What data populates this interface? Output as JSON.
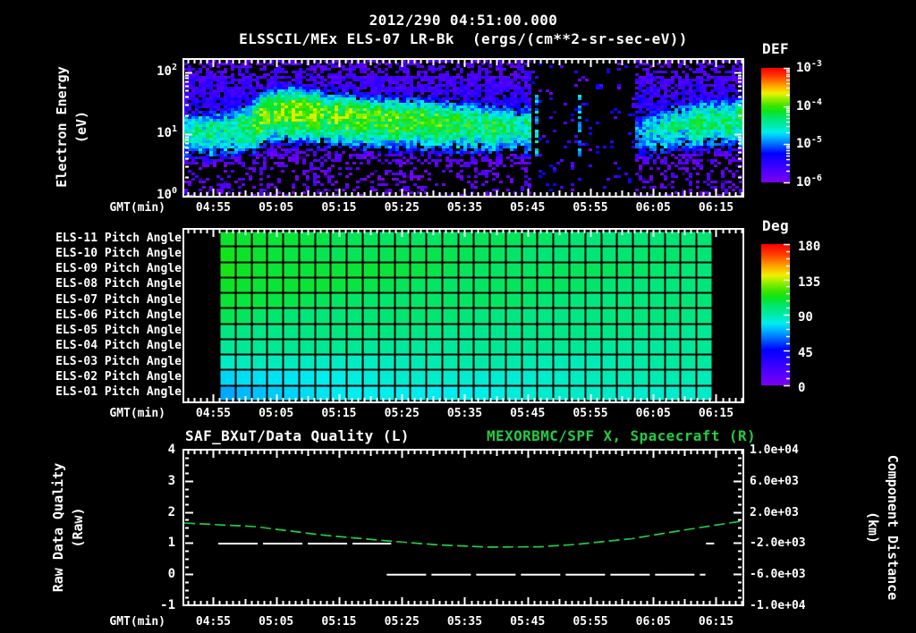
{
  "header": {
    "datetime": "2012/290 04:51:00.000",
    "instrument_title": "ELSSCIL/MEx ELS-07 LR-Bk  (ergs/(cm**2-sr-sec-eV))"
  },
  "colors": {
    "background": "#000000",
    "foreground": "#ffffff",
    "accent_green": "#22cc44",
    "rainbow_stops": [
      [
        0,
        "#7a00f0"
      ],
      [
        0.13,
        "#3c00ff"
      ],
      [
        0.25,
        "#0000ff"
      ],
      [
        0.33,
        "#0068ff"
      ],
      [
        0.39,
        "#00b4ff"
      ],
      [
        0.44,
        "#00eeee"
      ],
      [
        0.5,
        "#00eaa4"
      ],
      [
        0.56,
        "#00e674"
      ],
      [
        0.62,
        "#0ce41e"
      ],
      [
        0.67,
        "#3ce400"
      ],
      [
        0.73,
        "#96ee00"
      ],
      [
        0.78,
        "#f0f000"
      ],
      [
        0.85,
        "#ffa000"
      ],
      [
        0.93,
        "#ff3c00"
      ],
      [
        1,
        "#ff0000"
      ]
    ]
  },
  "time_axis": {
    "label": "GMT(min)",
    "range_min": [
      -0.62,
      88.2
    ],
    "tick_minutes": [
      4,
      14,
      24,
      34,
      44,
      54,
      64,
      74,
      84
    ],
    "tick_labels": [
      "04:55",
      "05:05",
      "05:15",
      "05:25",
      "05:35",
      "05:45",
      "05:55",
      "06:05",
      "06:15"
    ],
    "minor_step_min": 1
  },
  "chart_data": [
    {
      "type": "heatmap",
      "name": "electron-energy-spectrogram",
      "ylabel_line1": "Electron Energy",
      "ylabel_line2": "(eV)",
      "xlabel": "GMT(min)",
      "y_scale": "log",
      "y_ticks": [
        {
          "base": "10",
          "exp": "2",
          "log10": 2
        },
        {
          "base": "10",
          "exp": "1",
          "log10": 1
        },
        {
          "base": "10",
          "exp": "0",
          "log10": 0
        }
      ],
      "colorbar": {
        "title": "DEF",
        "units": "ergs/(cm**2-sr-sec-eV)",
        "tick_labels": [
          {
            "base": "10",
            "exp": "-3"
          },
          {
            "base": "10",
            "exp": "-4"
          },
          {
            "base": "10",
            "exp": "-5"
          },
          {
            "base": "10",
            "exp": "-6"
          }
        ],
        "range_log10": [
          -6,
          -3
        ]
      },
      "band_profile": [
        [
          -0.62,
          1.02,
          -4.55
        ],
        [
          6,
          1.06,
          -4.42
        ],
        [
          10,
          1.16,
          -4.15
        ],
        [
          12.5,
          1.35,
          -3.86
        ],
        [
          15,
          1.38,
          -3.8
        ],
        [
          18,
          1.38,
          -3.88
        ],
        [
          22,
          1.32,
          -3.98
        ],
        [
          27,
          1.27,
          -4.03
        ],
        [
          33,
          1.24,
          -4.08
        ],
        [
          38,
          1.21,
          -4.12
        ],
        [
          44,
          1.17,
          -4.2
        ],
        [
          50,
          1.13,
          -4.3
        ],
        [
          54,
          1.12,
          -4.45
        ],
        [
          54.9,
          1.1,
          -4.8
        ],
        [
          71.4,
          1.0,
          -5.0
        ],
        [
          72.5,
          1.03,
          -4.75
        ],
        [
          75,
          1.1,
          -4.55
        ],
        [
          79,
          1.18,
          -4.42
        ],
        [
          83,
          1.22,
          -4.32
        ],
        [
          88.2,
          1.24,
          -4.3
        ]
      ],
      "gap": {
        "t0": 54.8,
        "t1": 71.4,
        "dot_density": 0.06
      },
      "streak_minutes": [
        55.5,
        62.1,
        68.3,
        71.3
      ],
      "noise": {
        "seed": 20121290,
        "amplitude": 0.34,
        "sigma_above": 0.3,
        "sigma_below": 0.42,
        "above_floor": -5.5,
        "above_density": 0.82,
        "below_density": 0.5,
        "deep_density": 0.26
      }
    },
    {
      "type": "heatmap",
      "name": "pitch-angle-panel",
      "xlabel": "GMT(min)",
      "data_t_range": [
        4.9,
        83.4
      ],
      "n_cols": 31,
      "left_ease": 0.55,
      "rows": [
        {
          "label": "ELS-11 Pitch Angle",
          "left_deg": 110,
          "right_deg": 100
        },
        {
          "label": "ELS-10 Pitch Angle",
          "left_deg": 111,
          "right_deg": 100
        },
        {
          "label": "ELS-09 Pitch Angle",
          "left_deg": 114,
          "right_deg": 101
        },
        {
          "label": "ELS-08 Pitch Angle",
          "left_deg": 112,
          "right_deg": 100
        },
        {
          "label": "ELS-07 Pitch Angle",
          "left_deg": 108,
          "right_deg": 99
        },
        {
          "label": "ELS-06 Pitch Angle",
          "left_deg": 104,
          "right_deg": 97
        },
        {
          "label": "ELS-05 Pitch Angle",
          "left_deg": 99,
          "right_deg": 95
        },
        {
          "label": "ELS-04 Pitch Angle",
          "left_deg": 93,
          "right_deg": 93
        },
        {
          "label": "ELS-03 Pitch Angle",
          "left_deg": 84,
          "right_deg": 90
        },
        {
          "label": "ELS-02 Pitch Angle",
          "left_deg": 75,
          "right_deg": 88
        },
        {
          "label": "ELS-01 Pitch Angle",
          "left_deg": 70,
          "right_deg": 86
        }
      ],
      "colorbar": {
        "title": "Deg",
        "tick_labels": [
          "180",
          "135",
          "90",
          "45",
          "0"
        ],
        "range_deg": [
          0,
          180
        ]
      }
    },
    {
      "type": "line",
      "name": "quality-distance-panel",
      "title_left": "SAF_BXuT/Data Quality (L)",
      "title_right": "MEXORBMC/SPF X, Spacecraft (R)",
      "xlabel": "GMT(min)",
      "left_axis": {
        "label_line1": "Raw Data Quality",
        "label_line2": "(Raw)",
        "range": [
          4,
          -1
        ],
        "tick_labels": [
          "4",
          "3",
          "2",
          "1",
          "0",
          "-1"
        ],
        "minor_step": 0.25
      },
      "right_axis": {
        "label_line1": "Component Distance",
        "label_line2": "(km)",
        "range": [
          10000,
          -10000
        ],
        "tick_labels": [
          "1.0e+04",
          "6.0e+03",
          "2.0e+03",
          "-2.0e+03",
          "-6.0e+03",
          "-1.0e+04"
        ]
      },
      "series": [
        {
          "name": "SAF_BXuT/Data Quality",
          "axis": "left",
          "color": "#ffffff",
          "dash": [
            44,
            6
          ],
          "line_width": 2,
          "segments": [
            {
              "value": 1,
              "t0": 4.8,
              "t1": 32.3
            },
            {
              "value": 0,
              "t0": 31.6,
              "t1": 82.3
            },
            {
              "value": 1,
              "t0": 82.4,
              "t1": 83.7
            }
          ]
        },
        {
          "name": "MEXORBMC/SPF X, Spacecraft",
          "axis": "right",
          "color": "#22cc44",
          "dash": [
            12,
            5
          ],
          "line_width": 1.7,
          "points": [
            [
              -0.6,
              575
            ],
            [
              10.6,
              115
            ],
            [
              22,
              -1030
            ],
            [
              33.5,
              -1840
            ],
            [
              40,
              -2250
            ],
            [
              48,
              -2520
            ],
            [
              56,
              -2480
            ],
            [
              62,
              -2150
            ],
            [
              70.6,
              -1440
            ],
            [
              79.2,
              -290
            ],
            [
              88.2,
              840
            ]
          ]
        }
      ]
    }
  ]
}
